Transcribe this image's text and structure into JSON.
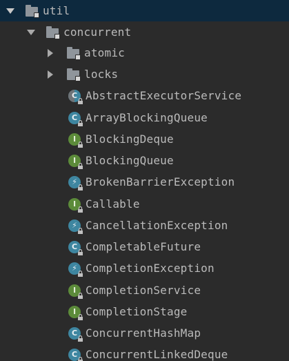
{
  "tree": {
    "root": {
      "label": "util",
      "expanded": true
    },
    "package": {
      "label": "concurrent",
      "expanded": true
    },
    "subpackages": [
      {
        "label": "atomic",
        "expanded": false
      },
      {
        "label": "locks",
        "expanded": false
      }
    ],
    "items": [
      {
        "label": "AbstractExecutorService",
        "kind": "abstract-class",
        "icon": "abstract-class-icon",
        "badge": "C"
      },
      {
        "label": "ArrayBlockingQueue",
        "kind": "class",
        "icon": "class-icon",
        "badge": "C"
      },
      {
        "label": "BlockingDeque",
        "kind": "interface",
        "icon": "interface-icon",
        "badge": "I"
      },
      {
        "label": "BlockingQueue",
        "kind": "interface",
        "icon": "interface-icon",
        "badge": "I"
      },
      {
        "label": "BrokenBarrierException",
        "kind": "exception",
        "icon": "exception-icon",
        "badge": "⚡"
      },
      {
        "label": "Callable",
        "kind": "interface",
        "icon": "interface-icon",
        "badge": "I"
      },
      {
        "label": "CancellationException",
        "kind": "exception",
        "icon": "exception-icon",
        "badge": "⚡"
      },
      {
        "label": "CompletableFuture",
        "kind": "class",
        "icon": "class-icon",
        "badge": "C"
      },
      {
        "label": "CompletionException",
        "kind": "exception",
        "icon": "exception-icon",
        "badge": "⚡"
      },
      {
        "label": "CompletionService",
        "kind": "interface",
        "icon": "interface-icon",
        "badge": "I"
      },
      {
        "label": "CompletionStage",
        "kind": "interface",
        "icon": "interface-icon",
        "badge": "I"
      },
      {
        "label": "ConcurrentHashMap",
        "kind": "class",
        "icon": "class-icon",
        "badge": "C"
      },
      {
        "label": "ConcurrentLinkedDeque",
        "kind": "class",
        "icon": "class-icon",
        "badge": "C"
      }
    ]
  },
  "colors": {
    "background": "#2b2b2b",
    "selected_row": "#0d293e",
    "text": "#bbbbbb",
    "class_icon": "#3e86a0",
    "interface_icon": "#5c8b3a",
    "folder_icon": "#8f959b"
  }
}
